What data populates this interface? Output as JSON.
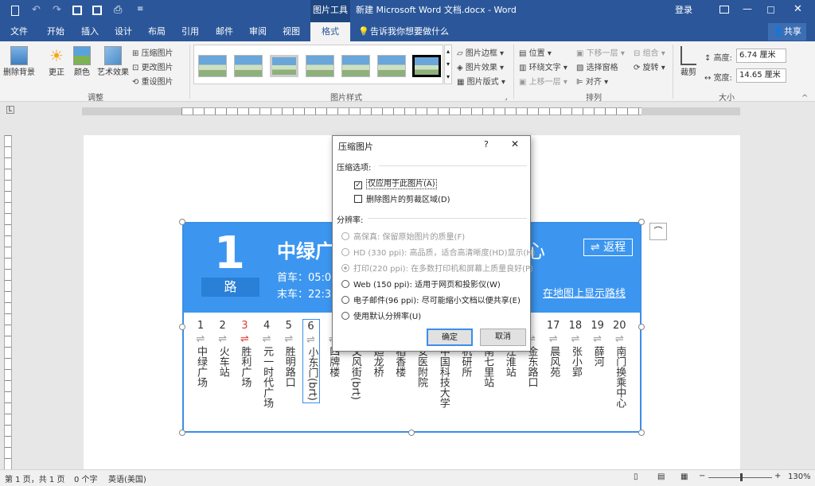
{
  "titlebar": {
    "title": "新建 Microsoft Word 文档.docx - Word",
    "context_tab": "图片工具",
    "login": "登录"
  },
  "tabs": [
    "文件",
    "开始",
    "插入",
    "设计",
    "布局",
    "引用",
    "邮件",
    "审阅",
    "视图",
    "格式"
  ],
  "tell_me": "告诉我你想要做什么",
  "share": "共享",
  "ribbon": {
    "remove_bg": "删除背景",
    "correct": "更正",
    "color": "颜色",
    "artistic": "艺术效果",
    "compress": "压缩图片",
    "change": "更改图片",
    "reset": "重设图片",
    "group_adjust": "调整",
    "group_styles": "图片样式",
    "border": "图片边框",
    "effects": "图片效果",
    "layout": "图片版式",
    "position": "位置",
    "wrap": "环绕文字",
    "forward": "上移一层",
    "backward": "下移一层",
    "selection": "选择窗格",
    "align": "对齐",
    "group": "组合",
    "rotate": "旋转",
    "group_arrange": "排列",
    "crop": "裁剪",
    "height_label": "高度:",
    "height_value": "6.74 厘米",
    "width_label": "宽度:",
    "width_value": "14.65 厘米",
    "group_size": "大小"
  },
  "bus": {
    "number": "1",
    "lu": "路",
    "name": "中绿广",
    "name_tail": "心",
    "first": "首车：05:0",
    "last": "末车：22:3",
    "back": "⇌ 返程",
    "map_link": "在地图上显示路线",
    "stops": [
      {
        "n": "1",
        "name": "中绿广场"
      },
      {
        "n": "2",
        "name": "火车站"
      },
      {
        "n": "3",
        "name": "胜利广场"
      },
      {
        "n": "4",
        "name": "元一时代广场"
      },
      {
        "n": "5",
        "name": "胜明路口"
      },
      {
        "n": "6",
        "name": "小东门(brt)"
      },
      {
        "n": "",
        "name": "四牌楼"
      },
      {
        "n": "",
        "name": "文风街(brt)"
      },
      {
        "n": "",
        "name": "廻龙桥"
      },
      {
        "n": "",
        "name": "稻香楼"
      },
      {
        "n": "",
        "name": "安医附院"
      },
      {
        "n": "",
        "name": "中国科技大学"
      },
      {
        "n": "",
        "name": "机研所"
      },
      {
        "n": "",
        "name": "南七里站"
      },
      {
        "n": "",
        "name": "江淮站"
      },
      {
        "n": "",
        "name": "金东路口"
      },
      {
        "n": "17",
        "name": "晨风苑"
      },
      {
        "n": "18",
        "name": "张小郢"
      },
      {
        "n": "19",
        "name": "薛河"
      },
      {
        "n": "20",
        "name": "南门换乘中心"
      }
    ]
  },
  "dialog": {
    "title": "压缩图片",
    "help": "?",
    "close": "✕",
    "section1": "压缩选项:",
    "opt_apply": "仅应用于此图片(A)",
    "opt_delete": "删除图片的剪裁区域(D)",
    "section2": "分辨率:",
    "res": [
      "高保真: 保留原始图片的质量(F)",
      "HD (330 ppi): 高品质，适合高清晰度(HD)显示(H)",
      "打印(220 ppi): 在多数打印机和屏幕上质量良好(P)",
      "Web (150 ppi): 适用于网页和投影仪(W)",
      "电子邮件(96 ppi): 尽可能缩小文档以便共享(E)",
      "使用默认分辨率(U)"
    ],
    "ok": "确定",
    "cancel": "取消"
  },
  "status": {
    "page": "第 1 页，共 1 页",
    "words": "0 个字",
    "lang": "英语(美国)",
    "zoom": "130%"
  }
}
